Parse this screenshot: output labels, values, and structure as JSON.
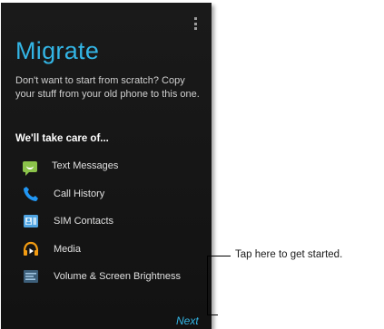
{
  "screen": {
    "title": "Migrate",
    "description": "Don't want to start from scratch? Copy your stuff from your old phone to this one.",
    "subtitle": "We'll take care of...",
    "items": [
      {
        "label": "Text Messages",
        "icon": "text-messages-icon"
      },
      {
        "label": "Call History",
        "icon": "call-history-icon"
      },
      {
        "label": "SIM Contacts",
        "icon": "sim-contacts-icon"
      },
      {
        "label": "Media",
        "icon": "media-icon"
      },
      {
        "label": "Volume & Screen Brightness",
        "icon": "volume-brightness-icon"
      }
    ],
    "next_label": "Next"
  },
  "callout": {
    "text": "Tap here to get started."
  },
  "colors": {
    "accent": "#33b5e5",
    "background": "#121212",
    "messages_icon": "#8bc34a",
    "call_icon": "#2196f3"
  }
}
